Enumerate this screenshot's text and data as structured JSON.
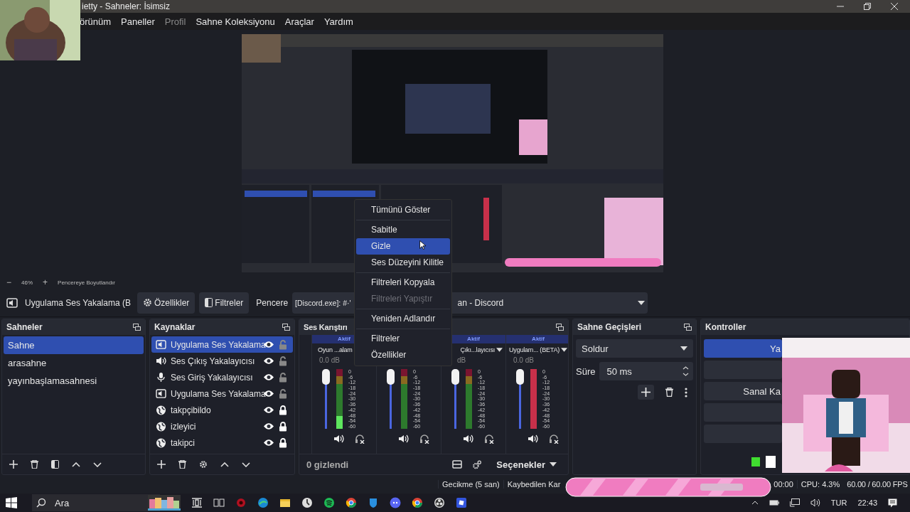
{
  "window": {
    "title": "ietty - Sahneler: İsimsiz"
  },
  "menu": [
    {
      "label": "örünüm",
      "disabled": false
    },
    {
      "label": "Paneller",
      "disabled": false
    },
    {
      "label": "Profil",
      "disabled": true
    },
    {
      "label": "Sahne Koleksiyonu",
      "disabled": false
    },
    {
      "label": "Araçlar",
      "disabled": false
    },
    {
      "label": "Yardım",
      "disabled": false
    }
  ],
  "zoom": {
    "minus": "−",
    "value": "46%",
    "plus": "+",
    "mode": "Pencereye Boyutlandır"
  },
  "source_toolbar": {
    "source": "Uygulama Ses Yakalama (B",
    "properties": "Özellikler",
    "filters": "Filtreler",
    "label": "Pencere",
    "value_start": "[Discord.exe]: #·'",
    "value_end": "an - Discord"
  },
  "scenes": {
    "title": "Sahneler",
    "items": [
      {
        "label": "Sahne",
        "selected": true
      },
      {
        "label": "arasahne",
        "selected": false
      },
      {
        "label": "yayınbaşlamasahnesi",
        "selected": false
      }
    ]
  },
  "sources": {
    "title": "Kaynaklar",
    "items": [
      {
        "kind": "app-audio",
        "label": "Uygulama Ses Yakalama",
        "visible": true,
        "locked": false,
        "selected": true
      },
      {
        "kind": "audio-output",
        "label": "Ses Çıkış Yakalayıcısı",
        "visible": true,
        "locked": false,
        "selected": false
      },
      {
        "kind": "audio-input",
        "label": "Ses Giriş Yakalayıcısı",
        "visible": true,
        "locked": false,
        "selected": false
      },
      {
        "kind": "app-audio",
        "label": "Uygulama Ses Yakalama",
        "visible": true,
        "locked": false,
        "selected": false
      },
      {
        "kind": "browser",
        "label": "takpçibildo",
        "visible": true,
        "locked": true,
        "selected": false
      },
      {
        "kind": "browser",
        "label": "izleyici",
        "visible": true,
        "locked": true,
        "selected": false
      },
      {
        "kind": "browser",
        "label": "takipci",
        "visible": true,
        "locked": true,
        "selected": false
      }
    ]
  },
  "mixer": {
    "title": "Ses Karıştırı",
    "hidden_count": "0 gizlendi",
    "options": "Seçenekler",
    "channels": [
      {
        "status": "Aktif",
        "name": "Oyun ...alam",
        "db": "0.0 dB",
        "muted": false,
        "volume": {
          "level": 1
        },
        "meter": {
          "level": 0.22
        },
        "scale": [
          "0",
          "-6",
          "-12",
          "-18",
          "-24",
          "-30",
          "-36",
          "-42",
          "-48",
          "-54",
          "-60"
        ]
      },
      {
        "muted": false,
        "volume": {
          "level": 1
        },
        "scale": [
          "0",
          "-6",
          "-12",
          "-18",
          "-24",
          "-30",
          "-36",
          "-42",
          "-48",
          "-54",
          "-60"
        ]
      },
      {
        "status": "Aktif",
        "name": "Çıkı...layıcısı",
        "db": "dB",
        "muted": false,
        "volume": {
          "level": 1
        },
        "scale": [
          "0",
          "-6",
          "-12",
          "-18",
          "-24",
          "-30",
          "-36",
          "-42",
          "-48",
          "-54",
          "-60"
        ]
      },
      {
        "status": "Aktif",
        "name": "Uygulam... (BETA)",
        "db": "0.0 dB",
        "muted": true,
        "volume": {
          "level": 1
        },
        "scale": [
          "0",
          "-6",
          "-12",
          "-18",
          "-24",
          "-30",
          "-36",
          "-42",
          "-48",
          "-54",
          "-60"
        ]
      }
    ]
  },
  "transitions": {
    "title": "Sahne Geçişleri",
    "type": "Soldur",
    "duration_label": "Süre",
    "duration": "50 ms"
  },
  "controls": {
    "title": "Kontroller",
    "buttons": [
      {
        "label": "Ya",
        "active": true
      },
      {
        "active": false
      },
      {
        "label": "Sanal Ka",
        "active": false
      },
      {
        "active": false
      },
      {
        "active": false
      }
    ]
  },
  "context_menu": [
    {
      "kind": "item",
      "label": "Tümünü Göster",
      "selected": false,
      "disabled": false
    },
    {
      "kind": "separator"
    },
    {
      "kind": "item",
      "label": "Sabitle",
      "selected": false,
      "disabled": false
    },
    {
      "kind": "item",
      "label": "Gizle",
      "selected": true,
      "disabled": false
    },
    {
      "kind": "item",
      "label": "Ses Düzeyini Kilitle",
      "selected": false,
      "disabled": false
    },
    {
      "kind": "separator"
    },
    {
      "kind": "item",
      "label": "Filtreleri Kopyala",
      "selected": false,
      "disabled": false
    },
    {
      "kind": "item",
      "label": "Filtreleri Yapıştır",
      "selected": false,
      "disabled": true
    },
    {
      "kind": "separator"
    },
    {
      "kind": "item",
      "label": "Yeniden Adlandır",
      "selected": false,
      "disabled": false
    },
    {
      "kind": "separator"
    },
    {
      "kind": "item",
      "label": "Filtreler",
      "selected": false,
      "disabled": false
    },
    {
      "kind": "item",
      "label": "Özellikler",
      "selected": false,
      "disabled": false
    }
  ],
  "status_bar": {
    "delay": "Gecikme (5 san)",
    "dropped": "Kaybedilen Kar",
    "time": "00:00",
    "cpu": "CPU: 4.3%",
    "fps": "60.00 / 60.00 FPS"
  },
  "taskbar": {
    "search": "Ara",
    "language": "TUR",
    "clock": "22:43"
  }
}
